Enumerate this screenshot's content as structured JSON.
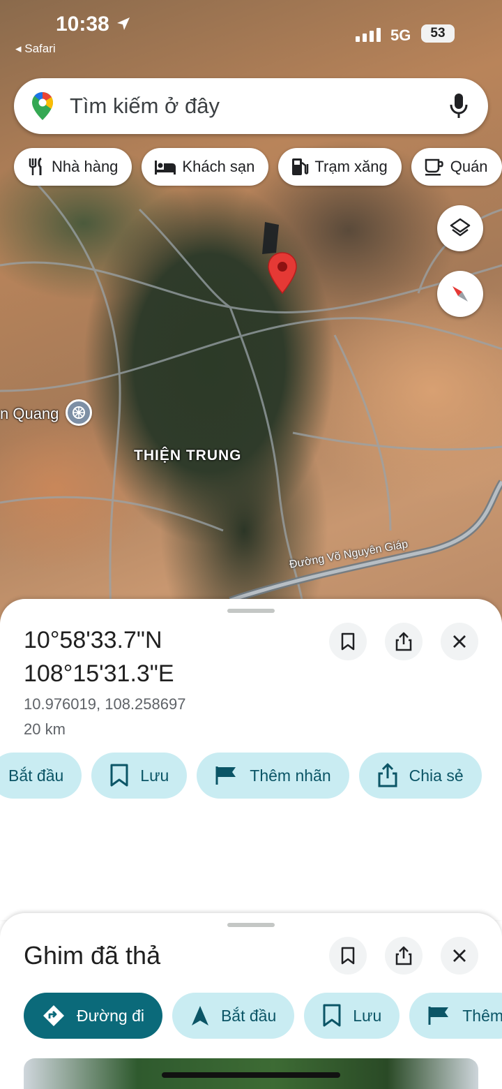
{
  "status_bar": {
    "time": "10:38",
    "back_app": "◂ Safari",
    "network": "5G",
    "battery": "53"
  },
  "search": {
    "placeholder": "Tìm kiếm ở đây"
  },
  "chips": [
    {
      "label": "Nhà hàng",
      "icon": "fork-knife-icon"
    },
    {
      "label": "Khách sạn",
      "icon": "bed-icon"
    },
    {
      "label": "Trạm xăng",
      "icon": "gas-pump-icon"
    },
    {
      "label": "Quán",
      "icon": "cafe-icon"
    }
  ],
  "map": {
    "place_label": "THIỆN TRUNG",
    "poi_label": "n Quang",
    "road_label": "Đường Võ Nguyên Giáp"
  },
  "pin_sheet": {
    "lat_dms": "10°58'33.7\"N",
    "lng_dms": "108°15'31.3\"E",
    "decimal": "10.976019, 108.258697",
    "distance": "20 km",
    "actions": [
      {
        "label": "Bắt đầu"
      },
      {
        "label": "Lưu"
      },
      {
        "label": "Thêm nhãn"
      },
      {
        "label": "Chia sẻ"
      }
    ]
  },
  "dropped_sheet": {
    "title": "Ghim đã thả",
    "actions": [
      {
        "label": "Đường đi"
      },
      {
        "label": "Bắt đầu"
      },
      {
        "label": "Lưu"
      },
      {
        "label": "Thêm"
      }
    ]
  },
  "colors": {
    "accent_dark": "#0b6a7a",
    "accent_light": "#c9ecf2",
    "pin_red": "#e53935"
  }
}
